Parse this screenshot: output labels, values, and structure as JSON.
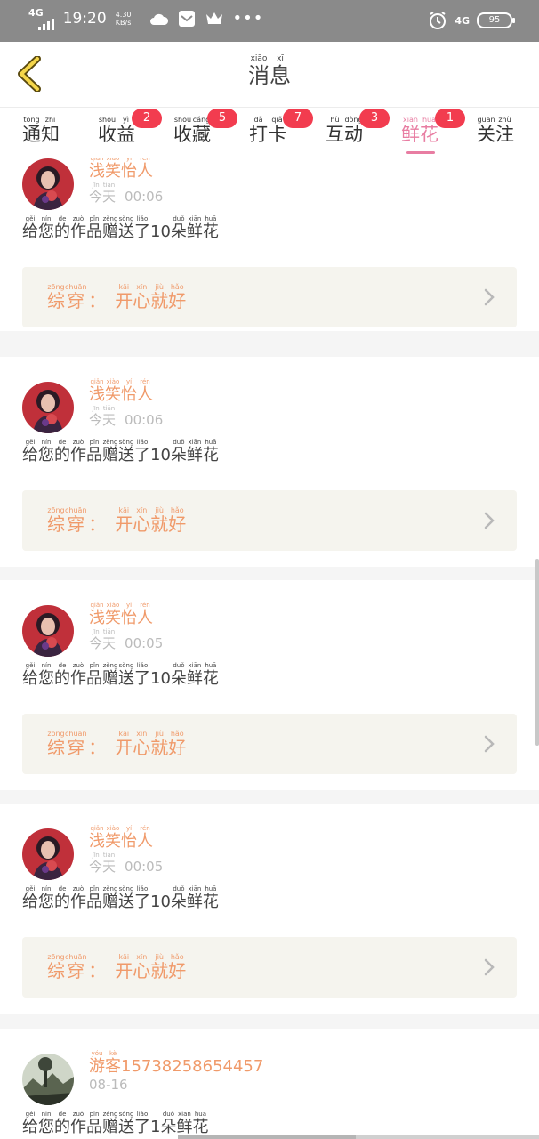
{
  "status_bar": {
    "network": "4G",
    "time": "19:20",
    "speed_value": "4.30",
    "speed_unit": "KB/s",
    "more": "•••",
    "right_network": "4G",
    "battery": "95"
  },
  "header": {
    "title": [
      [
        "消",
        "xiāo"
      ],
      [
        "息",
        "xī"
      ]
    ]
  },
  "tabs": [
    {
      "label": [
        [
          "通",
          "tōng"
        ],
        [
          "知",
          "zhī"
        ]
      ],
      "badge": "",
      "active": false
    },
    {
      "label": [
        [
          "收",
          "shōu"
        ],
        [
          "益",
          "yì"
        ]
      ],
      "badge": "2",
      "active": false
    },
    {
      "label": [
        [
          "收",
          "shōu"
        ],
        [
          "藏",
          "cáng"
        ]
      ],
      "badge": "5",
      "active": false
    },
    {
      "label": [
        [
          "打",
          "dǎ"
        ],
        [
          "卡",
          "qiǎ"
        ]
      ],
      "badge": "7",
      "active": false
    },
    {
      "label": [
        [
          "互",
          "hù"
        ],
        [
          "动",
          "dòng"
        ]
      ],
      "badge": "3",
      "active": false
    },
    {
      "label": [
        [
          "鲜",
          "xiān"
        ],
        [
          "花",
          "huā"
        ]
      ],
      "badge": "1",
      "active": true
    },
    {
      "label": [
        [
          "关",
          "guān"
        ],
        [
          "注",
          "zhù"
        ]
      ],
      "badge": "",
      "active": false
    }
  ],
  "messages": [
    {
      "user": [
        [
          "浅",
          "qiǎn"
        ],
        [
          "笑",
          "xiào"
        ],
        [
          "怡",
          "yí"
        ],
        [
          "人",
          "rén"
        ]
      ],
      "user_plain": "",
      "date": [
        [
          "今",
          "jīn"
        ],
        [
          "天",
          "tiān"
        ]
      ],
      "time": "00:06",
      "avatar": "portrait",
      "text_before": [
        [
          "给",
          "gěi"
        ],
        [
          "您",
          "nín"
        ],
        [
          "的",
          "de"
        ],
        [
          "作",
          "zuò"
        ],
        [
          "品",
          "pǐn"
        ],
        [
          "赠",
          "zèng"
        ],
        [
          "送",
          "sòng"
        ],
        [
          "了",
          "liǎo"
        ]
      ],
      "count": "10",
      "text_after": [
        [
          "朵",
          "duǒ"
        ],
        [
          "鲜",
          "xiān"
        ],
        [
          "花",
          "huā"
        ]
      ],
      "work_prefix": [
        [
          "综",
          "zōng"
        ],
        [
          "穿",
          "chuān"
        ]
      ],
      "work_colon": "：",
      "work_title": [
        [
          "开",
          "kāi"
        ],
        [
          "心",
          "xīn"
        ],
        [
          "就",
          "jiù"
        ],
        [
          "好",
          "hǎo"
        ]
      ]
    },
    {
      "user": [
        [
          "浅",
          "qiǎn"
        ],
        [
          "笑",
          "xiào"
        ],
        [
          "怡",
          "yí"
        ],
        [
          "人",
          "rén"
        ]
      ],
      "user_plain": "",
      "date": [
        [
          "今",
          "jīn"
        ],
        [
          "天",
          "tiān"
        ]
      ],
      "time": "00:06",
      "avatar": "portrait",
      "text_before": [
        [
          "给",
          "gěi"
        ],
        [
          "您",
          "nín"
        ],
        [
          "的",
          "de"
        ],
        [
          "作",
          "zuò"
        ],
        [
          "品",
          "pǐn"
        ],
        [
          "赠",
          "zèng"
        ],
        [
          "送",
          "sòng"
        ],
        [
          "了",
          "liǎo"
        ]
      ],
      "count": "10",
      "text_after": [
        [
          "朵",
          "duǒ"
        ],
        [
          "鲜",
          "xiān"
        ],
        [
          "花",
          "huā"
        ]
      ],
      "work_prefix": [
        [
          "综",
          "zōng"
        ],
        [
          "穿",
          "chuān"
        ]
      ],
      "work_colon": "：",
      "work_title": [
        [
          "开",
          "kāi"
        ],
        [
          "心",
          "xīn"
        ],
        [
          "就",
          "jiù"
        ],
        [
          "好",
          "hǎo"
        ]
      ]
    },
    {
      "user": [
        [
          "浅",
          "qiǎn"
        ],
        [
          "笑",
          "xiào"
        ],
        [
          "怡",
          "yí"
        ],
        [
          "人",
          "rén"
        ]
      ],
      "user_plain": "",
      "date": [
        [
          "今",
          "jīn"
        ],
        [
          "天",
          "tiān"
        ]
      ],
      "time": "00:05",
      "avatar": "portrait",
      "text_before": [
        [
          "给",
          "gěi"
        ],
        [
          "您",
          "nín"
        ],
        [
          "的",
          "de"
        ],
        [
          "作",
          "zuò"
        ],
        [
          "品",
          "pǐn"
        ],
        [
          "赠",
          "zèng"
        ],
        [
          "送",
          "sòng"
        ],
        [
          "了",
          "liǎo"
        ]
      ],
      "count": "10",
      "text_after": [
        [
          "朵",
          "duǒ"
        ],
        [
          "鲜",
          "xiān"
        ],
        [
          "花",
          "huā"
        ]
      ],
      "work_prefix": [
        [
          "综",
          "zōng"
        ],
        [
          "穿",
          "chuān"
        ]
      ],
      "work_colon": "：",
      "work_title": [
        [
          "开",
          "kāi"
        ],
        [
          "心",
          "xīn"
        ],
        [
          "就",
          "jiù"
        ],
        [
          "好",
          "hǎo"
        ]
      ]
    },
    {
      "user": [
        [
          "浅",
          "qiǎn"
        ],
        [
          "笑",
          "xiào"
        ],
        [
          "怡",
          "yí"
        ],
        [
          "人",
          "rén"
        ]
      ],
      "user_plain": "",
      "date": [
        [
          "今",
          "jīn"
        ],
        [
          "天",
          "tiān"
        ]
      ],
      "time": "00:05",
      "avatar": "portrait",
      "text_before": [
        [
          "给",
          "gěi"
        ],
        [
          "您",
          "nín"
        ],
        [
          "的",
          "de"
        ],
        [
          "作",
          "zuò"
        ],
        [
          "品",
          "pǐn"
        ],
        [
          "赠",
          "zèng"
        ],
        [
          "送",
          "sòng"
        ],
        [
          "了",
          "liǎo"
        ]
      ],
      "count": "10",
      "text_after": [
        [
          "朵",
          "duǒ"
        ],
        [
          "鲜",
          "xiān"
        ],
        [
          "花",
          "huā"
        ]
      ],
      "work_prefix": [
        [
          "综",
          "zōng"
        ],
        [
          "穿",
          "chuān"
        ]
      ],
      "work_colon": "：",
      "work_title": [
        [
          "开",
          "kāi"
        ],
        [
          "心",
          "xīn"
        ],
        [
          "就",
          "jiù"
        ],
        [
          "好",
          "hǎo"
        ]
      ]
    },
    {
      "user": [
        [
          "游",
          "yóu"
        ],
        [
          "客",
          "kè"
        ]
      ],
      "user_plain": "15738258654457",
      "date": [],
      "time": "08-16",
      "avatar": "landscape",
      "text_before": [
        [
          "给",
          "gěi"
        ],
        [
          "您",
          "nín"
        ],
        [
          "的",
          "de"
        ],
        [
          "作",
          "zuò"
        ],
        [
          "品",
          "pǐn"
        ],
        [
          "赠",
          "zèng"
        ],
        [
          "送",
          "sòng"
        ],
        [
          "了",
          "liǎo"
        ]
      ],
      "count": "1",
      "text_after": [
        [
          "朵",
          "duǒ"
        ],
        [
          "鲜",
          "xiān"
        ],
        [
          "花",
          "huā"
        ]
      ],
      "work_prefix": [],
      "work_colon": "",
      "work_title": []
    }
  ],
  "colors": {
    "accent": "#e87da2",
    "badge": "#f23c4f",
    "username": "#f09a6a",
    "work_bg": "#f5f4ee"
  }
}
